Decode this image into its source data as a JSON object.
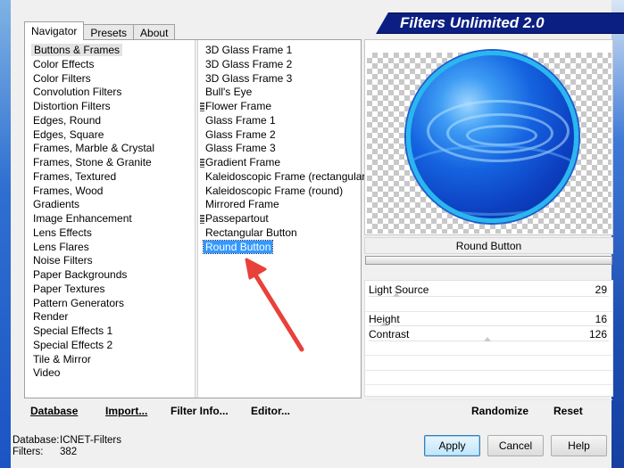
{
  "window": {
    "title": "Filters Unlimited 2.0"
  },
  "tabs": [
    {
      "label": "Navigator",
      "active": true
    },
    {
      "label": "Presets",
      "active": false
    },
    {
      "label": "About",
      "active": false
    }
  ],
  "categories": [
    "Buttons & Frames",
    "Color Effects",
    "Color Filters",
    "Convolution Filters",
    "Distortion Filters",
    "Edges, Round",
    "Edges, Square",
    "Frames, Marble & Crystal",
    "Frames, Stone & Granite",
    "Frames, Textured",
    "Frames, Wood",
    "Gradients",
    "Image Enhancement",
    "Lens Effects",
    "Lens Flares",
    "Noise Filters",
    "Paper Backgrounds",
    "Paper Textures",
    "Pattern Generators",
    "Render",
    "Special Effects 1",
    "Special Effects 2",
    "Tile & Mirror",
    "Video"
  ],
  "selected_category": "Buttons & Frames",
  "filters": [
    {
      "label": "3D Glass Frame 1",
      "fav": false
    },
    {
      "label": "3D Glass Frame 2",
      "fav": false
    },
    {
      "label": "3D Glass Frame 3",
      "fav": false
    },
    {
      "label": "Bull's Eye",
      "fav": false
    },
    {
      "label": "Flower Frame",
      "fav": true
    },
    {
      "label": "Glass Frame 1",
      "fav": false
    },
    {
      "label": "Glass Frame 2",
      "fav": false
    },
    {
      "label": "Glass Frame 3",
      "fav": false
    },
    {
      "label": "Gradient Frame",
      "fav": true
    },
    {
      "label": "Kaleidoscopic Frame (rectangular)",
      "fav": false
    },
    {
      "label": "Kaleidoscopic Frame (round)",
      "fav": false
    },
    {
      "label": "Mirrored Frame",
      "fav": false
    },
    {
      "label": "Passepartout",
      "fav": true
    },
    {
      "label": "Rectangular Button",
      "fav": false
    },
    {
      "label": "Round Button",
      "fav": false
    }
  ],
  "selected_filter": "Round Button",
  "bottom_buttons": {
    "database": "Database",
    "import": "Import...",
    "filter_info": "Filter Info...",
    "editor": "Editor..."
  },
  "preview": {
    "filter_name": "Round Button"
  },
  "controls": [
    {
      "label": "Light Source",
      "value": "29",
      "level": 0.114
    },
    {
      "label": "",
      "value": "",
      "level": null
    },
    {
      "label": "Height",
      "value": "16",
      "level": 0.063
    },
    {
      "label": "Contrast",
      "value": "126",
      "level": 0.494
    },
    {
      "label": "",
      "value": "",
      "level": null
    },
    {
      "label": "",
      "value": "",
      "level": null
    },
    {
      "label": "",
      "value": "",
      "level": null
    },
    {
      "label": "",
      "value": "",
      "level": null
    }
  ],
  "preset_buttons": {
    "randomize": "Randomize",
    "reset": "Reset"
  },
  "footer": {
    "database_label": "Database:",
    "database_value": "ICNET-Filters",
    "filters_label": "Filters:",
    "filters_value": "382"
  },
  "dialog_buttons": {
    "apply": "Apply",
    "cancel": "Cancel",
    "help": "Help"
  },
  "colors": {
    "title_bg": "#0b1f82",
    "selection_blue": "#3399ff",
    "annotation_arrow": "#e8413a",
    "orb_ring": "#29b7ef"
  }
}
